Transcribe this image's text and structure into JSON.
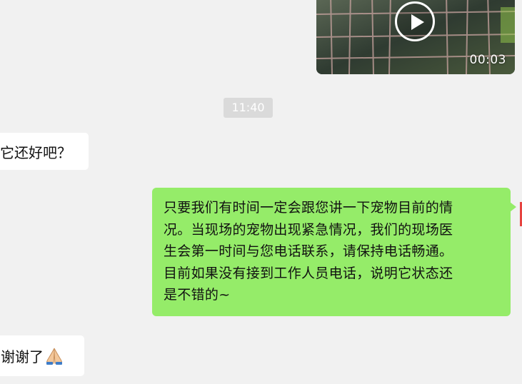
{
  "video": {
    "duration": "00:03"
  },
  "timestamp": "11:40",
  "messages": {
    "received_1": "它还好吧？",
    "sent_1_lines": [
      "只要我们有时间一定会跟您讲一下宠物目前的情",
      "况。当现场的宠物出现紧急情况，我们的现场医",
      "生会第一时间与您电话联系，请保持电话畅通。",
      "目前如果没有接到工作人员电话，说明它状态还",
      "是不错的~"
    ],
    "received_2": "谢谢了"
  },
  "icons": {
    "play": "play-icon",
    "pray": "folded-hands-emoji"
  },
  "colors": {
    "sent_bubble": "#95ec69",
    "received_bubble": "#ffffff",
    "background": "#f1f1f1",
    "time_chip": "#dadada"
  }
}
